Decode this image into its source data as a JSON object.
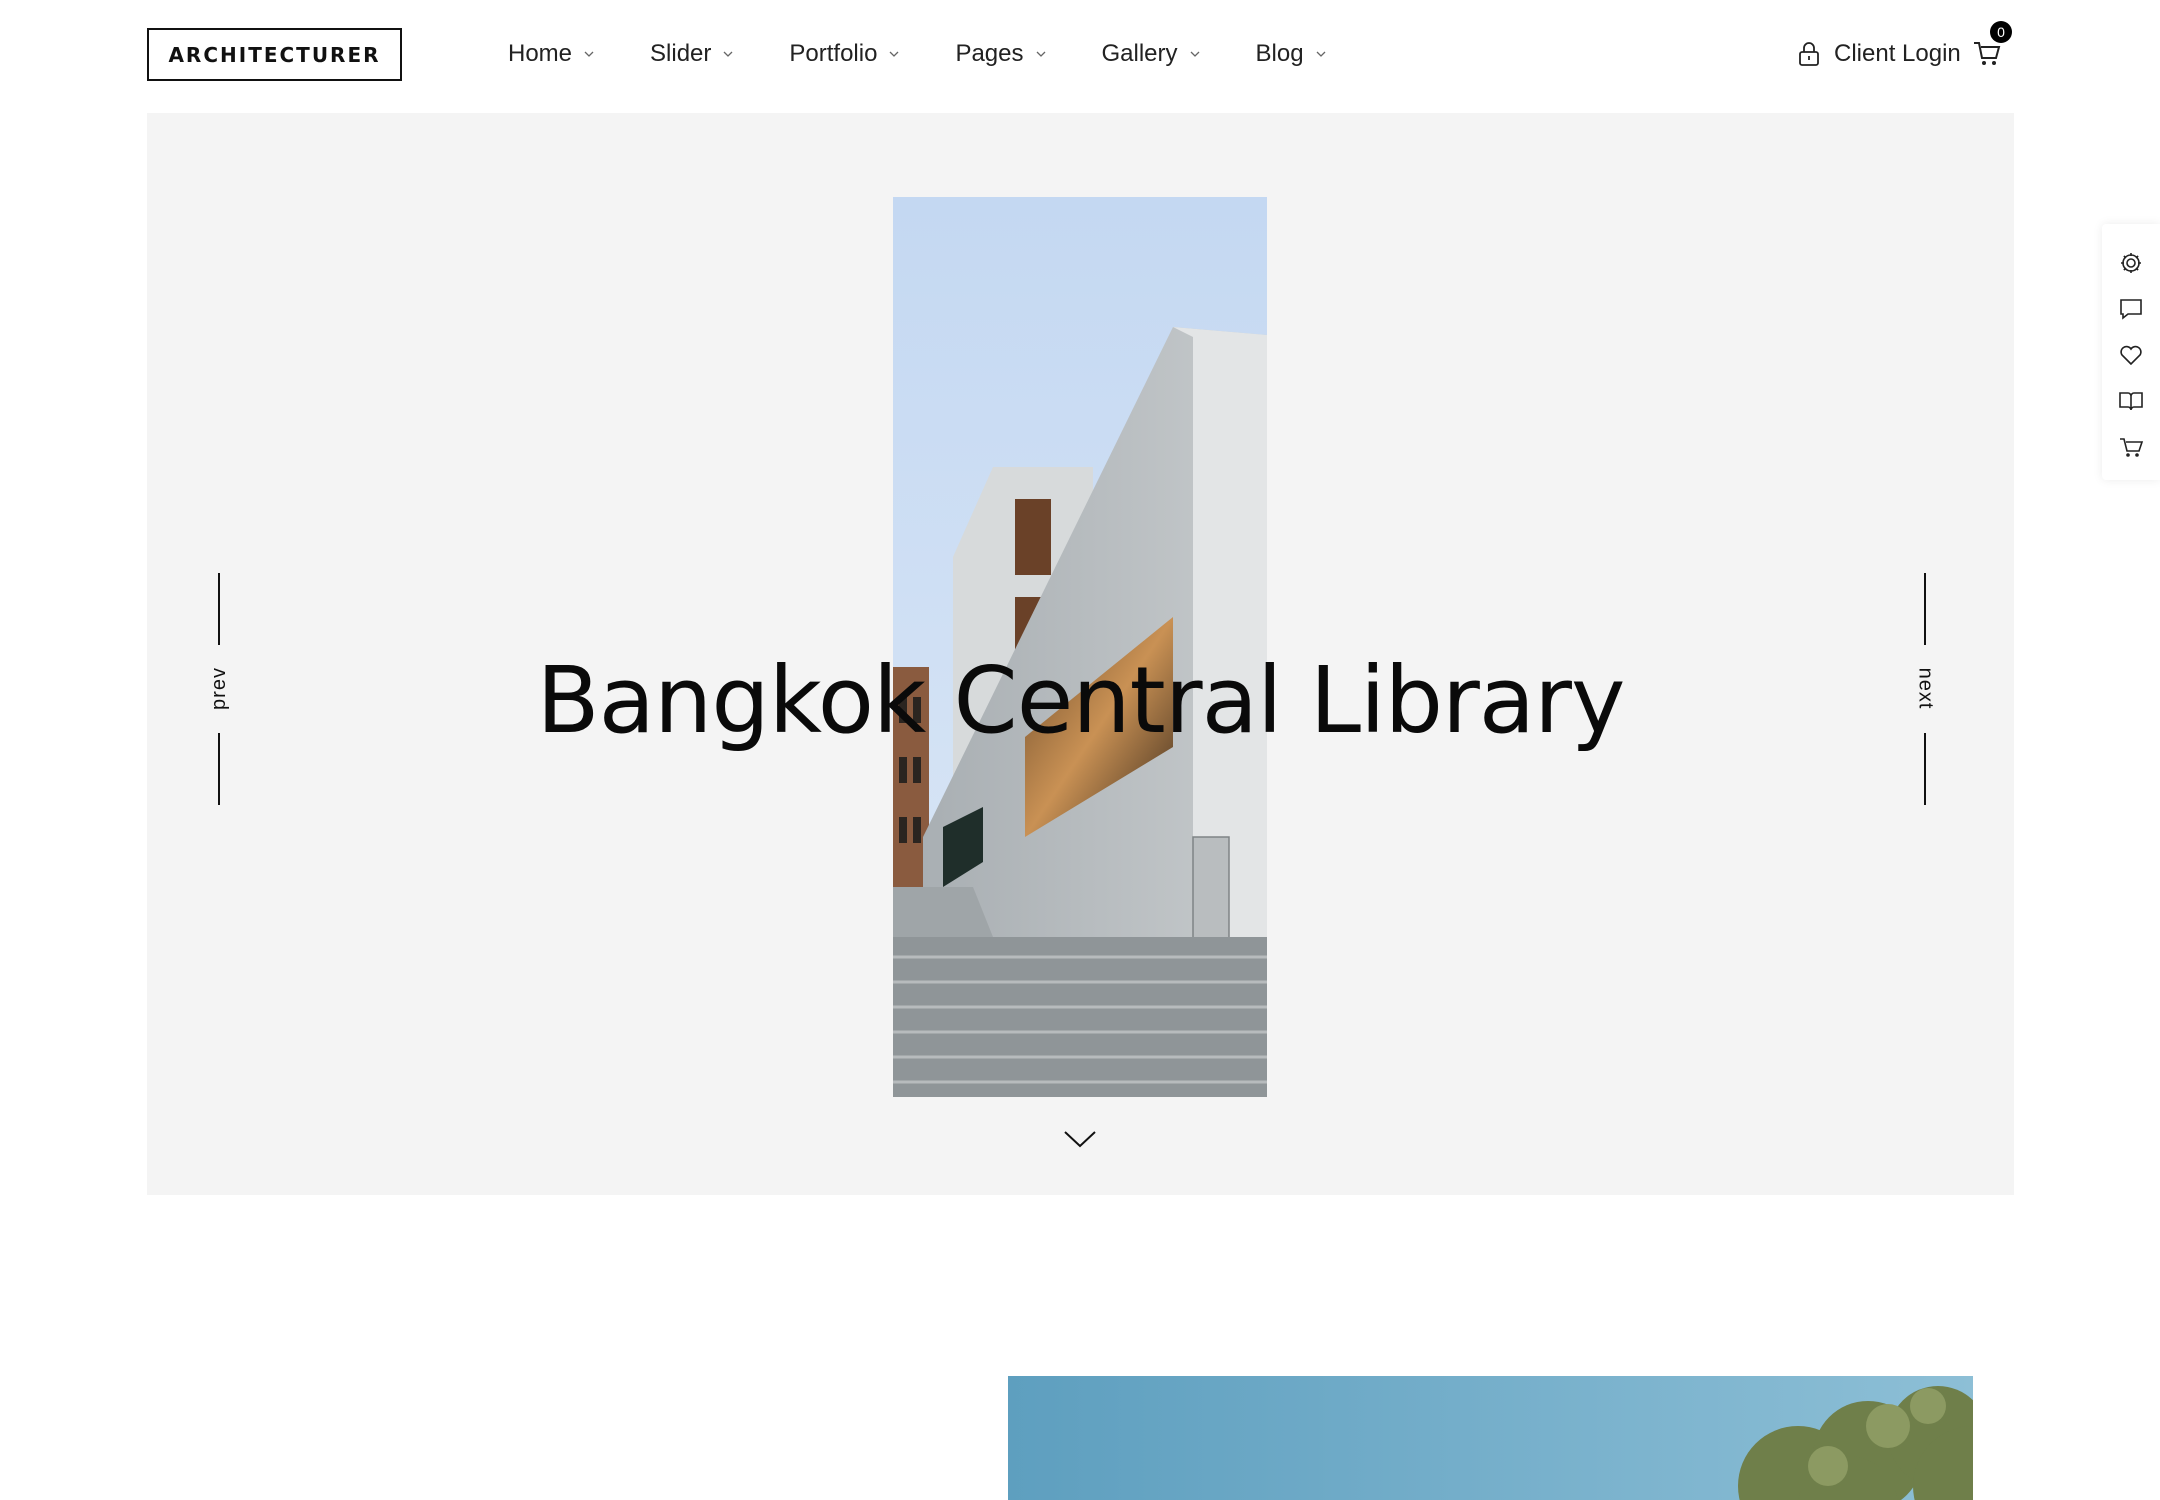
{
  "header": {
    "logo": "ARCHITECTURER",
    "nav": [
      {
        "label": "Home"
      },
      {
        "label": "Slider"
      },
      {
        "label": "Portfolio"
      },
      {
        "label": "Pages"
      },
      {
        "label": "Gallery"
      },
      {
        "label": "Blog"
      }
    ],
    "client_login": "Client Login",
    "cart_count": "0"
  },
  "hero": {
    "title": "Bangkok Central Library",
    "prev_label": "prev",
    "next_label": "next"
  },
  "side_panel": {
    "icons": [
      "gear-icon",
      "comment-icon",
      "heart-icon",
      "book-icon",
      "cart-icon"
    ]
  },
  "colors": {
    "hero_bg": "#f4f4f4",
    "text": "#111111",
    "badge": "#000000"
  }
}
